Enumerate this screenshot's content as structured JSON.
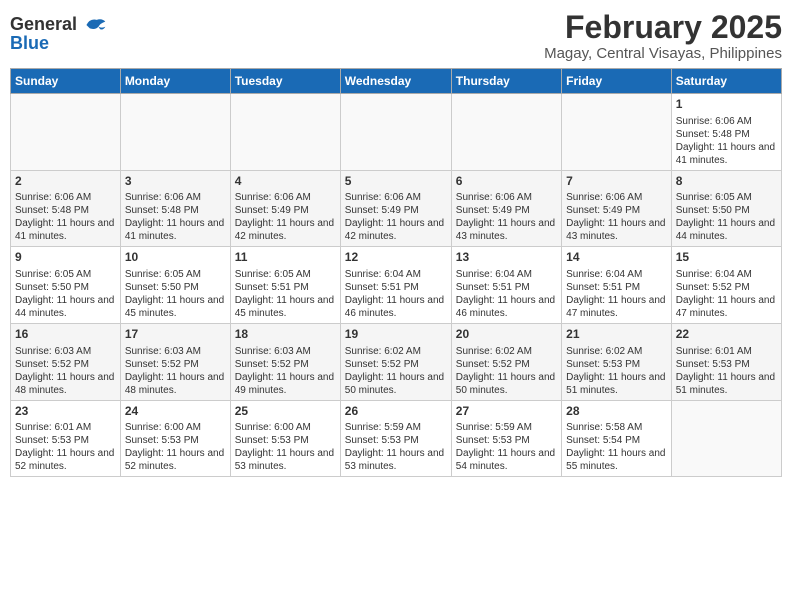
{
  "header": {
    "logo_general": "General",
    "logo_blue": "Blue",
    "title": "February 2025",
    "subtitle": "Magay, Central Visayas, Philippines"
  },
  "weekdays": [
    "Sunday",
    "Monday",
    "Tuesday",
    "Wednesday",
    "Thursday",
    "Friday",
    "Saturday"
  ],
  "weeks": [
    [
      {
        "day": "",
        "info": ""
      },
      {
        "day": "",
        "info": ""
      },
      {
        "day": "",
        "info": ""
      },
      {
        "day": "",
        "info": ""
      },
      {
        "day": "",
        "info": ""
      },
      {
        "day": "",
        "info": ""
      },
      {
        "day": "1",
        "info": "Sunrise: 6:06 AM\nSunset: 5:48 PM\nDaylight: 11 hours and 41 minutes."
      }
    ],
    [
      {
        "day": "2",
        "info": "Sunrise: 6:06 AM\nSunset: 5:48 PM\nDaylight: 11 hours and 41 minutes."
      },
      {
        "day": "3",
        "info": "Sunrise: 6:06 AM\nSunset: 5:48 PM\nDaylight: 11 hours and 41 minutes."
      },
      {
        "day": "4",
        "info": "Sunrise: 6:06 AM\nSunset: 5:49 PM\nDaylight: 11 hours and 42 minutes."
      },
      {
        "day": "5",
        "info": "Sunrise: 6:06 AM\nSunset: 5:49 PM\nDaylight: 11 hours and 42 minutes."
      },
      {
        "day": "6",
        "info": "Sunrise: 6:06 AM\nSunset: 5:49 PM\nDaylight: 11 hours and 43 minutes."
      },
      {
        "day": "7",
        "info": "Sunrise: 6:06 AM\nSunset: 5:49 PM\nDaylight: 11 hours and 43 minutes."
      },
      {
        "day": "8",
        "info": "Sunrise: 6:05 AM\nSunset: 5:50 PM\nDaylight: 11 hours and 44 minutes."
      }
    ],
    [
      {
        "day": "9",
        "info": "Sunrise: 6:05 AM\nSunset: 5:50 PM\nDaylight: 11 hours and 44 minutes."
      },
      {
        "day": "10",
        "info": "Sunrise: 6:05 AM\nSunset: 5:50 PM\nDaylight: 11 hours and 45 minutes."
      },
      {
        "day": "11",
        "info": "Sunrise: 6:05 AM\nSunset: 5:51 PM\nDaylight: 11 hours and 45 minutes."
      },
      {
        "day": "12",
        "info": "Sunrise: 6:04 AM\nSunset: 5:51 PM\nDaylight: 11 hours and 46 minutes."
      },
      {
        "day": "13",
        "info": "Sunrise: 6:04 AM\nSunset: 5:51 PM\nDaylight: 11 hours and 46 minutes."
      },
      {
        "day": "14",
        "info": "Sunrise: 6:04 AM\nSunset: 5:51 PM\nDaylight: 11 hours and 47 minutes."
      },
      {
        "day": "15",
        "info": "Sunrise: 6:04 AM\nSunset: 5:52 PM\nDaylight: 11 hours and 47 minutes."
      }
    ],
    [
      {
        "day": "16",
        "info": "Sunrise: 6:03 AM\nSunset: 5:52 PM\nDaylight: 11 hours and 48 minutes."
      },
      {
        "day": "17",
        "info": "Sunrise: 6:03 AM\nSunset: 5:52 PM\nDaylight: 11 hours and 48 minutes."
      },
      {
        "day": "18",
        "info": "Sunrise: 6:03 AM\nSunset: 5:52 PM\nDaylight: 11 hours and 49 minutes."
      },
      {
        "day": "19",
        "info": "Sunrise: 6:02 AM\nSunset: 5:52 PM\nDaylight: 11 hours and 50 minutes."
      },
      {
        "day": "20",
        "info": "Sunrise: 6:02 AM\nSunset: 5:52 PM\nDaylight: 11 hours and 50 minutes."
      },
      {
        "day": "21",
        "info": "Sunrise: 6:02 AM\nSunset: 5:53 PM\nDaylight: 11 hours and 51 minutes."
      },
      {
        "day": "22",
        "info": "Sunrise: 6:01 AM\nSunset: 5:53 PM\nDaylight: 11 hours and 51 minutes."
      }
    ],
    [
      {
        "day": "23",
        "info": "Sunrise: 6:01 AM\nSunset: 5:53 PM\nDaylight: 11 hours and 52 minutes."
      },
      {
        "day": "24",
        "info": "Sunrise: 6:00 AM\nSunset: 5:53 PM\nDaylight: 11 hours and 52 minutes."
      },
      {
        "day": "25",
        "info": "Sunrise: 6:00 AM\nSunset: 5:53 PM\nDaylight: 11 hours and 53 minutes."
      },
      {
        "day": "26",
        "info": "Sunrise: 5:59 AM\nSunset: 5:53 PM\nDaylight: 11 hours and 53 minutes."
      },
      {
        "day": "27",
        "info": "Sunrise: 5:59 AM\nSunset: 5:53 PM\nDaylight: 11 hours and 54 minutes."
      },
      {
        "day": "28",
        "info": "Sunrise: 5:58 AM\nSunset: 5:54 PM\nDaylight: 11 hours and 55 minutes."
      },
      {
        "day": "",
        "info": ""
      }
    ]
  ]
}
